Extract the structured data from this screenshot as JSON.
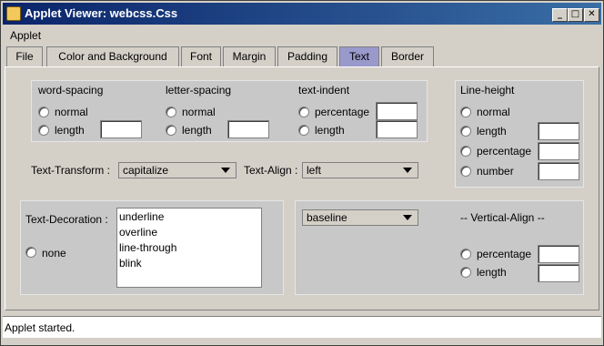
{
  "window": {
    "title": "Applet Viewer: webcss.Css"
  },
  "menu": {
    "applet": "Applet"
  },
  "tabs": [
    "File",
    "Color and Background",
    "Font",
    "Margin",
    "Padding",
    "Text",
    "Border"
  ],
  "active_tab": "Text",
  "word_spacing": {
    "title": "word-spacing",
    "opt1": "normal",
    "opt2": "length"
  },
  "letter_spacing": {
    "title": "letter-spacing",
    "opt1": "normal",
    "opt2": "length"
  },
  "text_indent": {
    "title": "text-indent",
    "opt1": "percentage",
    "opt2": "length"
  },
  "line_height": {
    "title": "Line-height",
    "opt1": "normal",
    "opt2": "length",
    "opt3": "percentage",
    "opt4": "number"
  },
  "text_transform": {
    "label": "Text-Transform :",
    "value": "capitalize"
  },
  "text_align": {
    "label": "Text-Align :",
    "value": "left"
  },
  "text_decoration": {
    "label": "Text-Decoration :",
    "none": "none",
    "items": [
      "underline",
      "overline",
      "line-through",
      "blink"
    ]
  },
  "vertical_align": {
    "title": "-- Vertical-Align --",
    "value": "baseline",
    "opt1": "percentage",
    "opt2": "length"
  },
  "status": "Applet started.",
  "colors": {
    "title_start": "#0a246a",
    "title_end": "#3a6ea5",
    "active_tab": "#9999cc"
  }
}
